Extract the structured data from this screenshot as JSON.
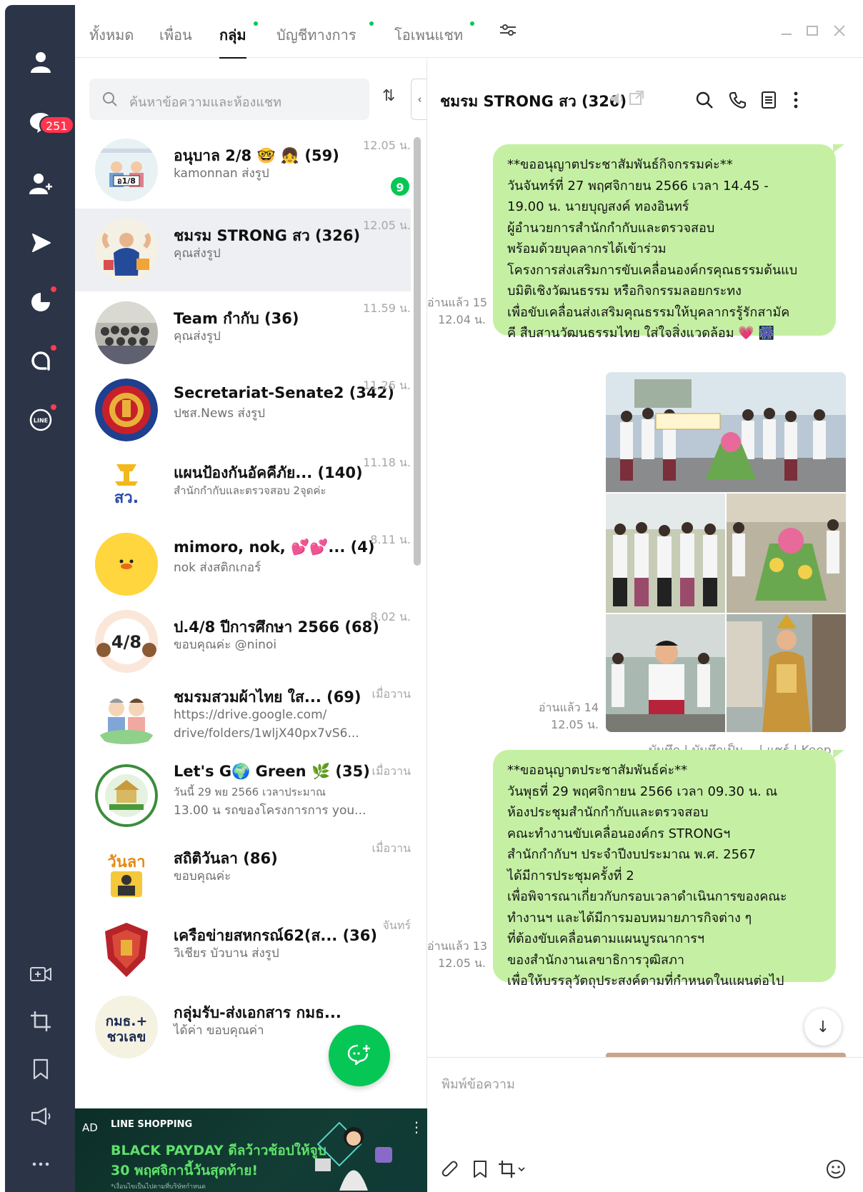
{
  "rail": {
    "badge_count": "251",
    "icons": [
      "user-icon",
      "chat-icon",
      "add-friend-icon",
      "voom-icon",
      "today-icon",
      "openchat-icon",
      "line-icon",
      "video-call-icon",
      "crop-icon",
      "bookmark-icon",
      "announce-icon",
      "more-icon"
    ]
  },
  "tabs": [
    {
      "label": "ทั้งหมด",
      "active": false,
      "dot": false
    },
    {
      "label": "เพื่อน",
      "active": false,
      "dot": false
    },
    {
      "label": "กลุ่ม",
      "active": true,
      "dot": true
    },
    {
      "label": "บัญชีทางการ",
      "active": false,
      "dot": true
    },
    {
      "label": "โอเพนแชท",
      "active": false,
      "dot": true
    }
  ],
  "search": {
    "placeholder": "ค้นหาข้อความและห้องแชท"
  },
  "chats": [
    {
      "title": "อนุบาล 2/8 🤓 👧 (59)",
      "sub": [
        "kamonnan ส่งรูป"
      ],
      "time": "12.05 น.",
      "unread": "9"
    },
    {
      "title": "ชมรม STRONG สว (326)",
      "sub": [
        "คุณส่งรูป"
      ],
      "time": "12.05 น.",
      "selected": true
    },
    {
      "title": "Team กำกับ (36)",
      "sub": [
        "คุณส่งรูป"
      ],
      "time": "11.59 น."
    },
    {
      "title": "Secretariat-Senate2 (342)",
      "sub": [
        "ปชส.News ส่งรูป"
      ],
      "time": "11.26 น."
    },
    {
      "title": "แผนป้องกันอัคคีภัย... (140)",
      "sub": [
        "สำนักกำกับและตรวจสอบ 2จุดค่ะ"
      ],
      "time": "11.18 น."
    },
    {
      "title": "mimoro, nok, 💕💕... (4)",
      "sub": [
        "nok ส่งสติกเกอร์"
      ],
      "time": "8.11 น."
    },
    {
      "title": "ป.4/8 ปีการศึกษา 2566 (68)",
      "sub": [
        "ขอบคุณค่ะ @ninoi"
      ],
      "time": "8.02 น."
    },
    {
      "title": "ชมรมสวมผ้าไทย ใส... (69)",
      "sub": [
        "https://drive.google.com/",
        "drive/folders/1wljX40px7vS6..."
      ],
      "time": "เมื่อวาน"
    },
    {
      "title": "Let's G🌍 Green 🌿 (35)",
      "sub": [
        "วันนี้ 29 พย 2566 เวลาประมาณ",
        "13.00 น รถของโครงการการ you..."
      ],
      "time": "เมื่อวาน"
    },
    {
      "title": "สถิติวันลา (86)",
      "sub": [
        "ขอบคุณค่ะ"
      ],
      "time": "เมื่อวาน"
    },
    {
      "title": "เครือข่ายสหกรณ์62(ส... (36)",
      "sub": [
        "วิเชียร บัวบาน ส่งรูป"
      ],
      "time": "จันทร์"
    },
    {
      "title": "กลุ่มรับ-ส่งเอกสาร กมธ...",
      "sub": [
        "ได้ค่า ขอบคุณค่า"
      ],
      "time": ""
    }
  ],
  "avatars": {
    "a1_label": "อ1/8",
    "a7_label": "4/8",
    "a10_label": "วันลา",
    "a12_top": "กมธ.+",
    "a12_bottom": "ชวเลข",
    "a5_label": "สว."
  },
  "ad": {
    "tag": "AD",
    "brand": "LINE SHOPPING",
    "line1": "BLACK PAYDAY ดีลว้าวช้อปให้จูบ",
    "line2": "30 พฤศจิกานี้วันสุดท้าย!",
    "fine": "*เงื่อนไขเป็นไปตามที่บริษัทกำหนด"
  },
  "chat": {
    "title": "ชมรม STRONG สว (326)",
    "messages": [
      {
        "lines": [
          "**ขออนุญาตประชาสัมพันธ์กิจกรรมค่ะ**",
          "วันจันทร์ที่ 27 พฤศจิกายน 2566 เวลา 14.45 -",
          "19.00 น. นายบุญสงค์ ทองอินทร์",
          "ผู้อำนวยการสำนักกำกับและตรวจสอบ",
          "พร้อมด้วยบุคลากรได้เข้าร่วม",
          "โครงการส่งเสริมการขับเคลื่อนองค์กรคุณธรรมต้นแบ",
          "บมิติเชิงวัฒนธรรม หรือกิจกรรมลอยกระทง",
          "เพื่อขับเคลื่อนส่งเสริมคุณธรรมให้บุคลากรรู้รักสามัค",
          "คี สืบสานวัฒนธรรมไทย ใส่ใจสิ่งแวดล้อม 💗 🎆"
        ],
        "read": "อ่านแล้ว 15",
        "time": "12.04 น."
      },
      {
        "read": "อ่านแล้ว 14",
        "time": "12.05 น.",
        "actions": "บันทึก | บันทึกเป็น... | แชร์ | Keep"
      },
      {
        "lines": [
          "**ขออนุญาตประชาสัมพันธ์ค่ะ**",
          "วันพุธที่ 29 พฤศจิกายน 2566 เวลา 09.30 น. ณ",
          "ห้องประชุมสำนักกำกับและตรวจสอบ",
          "คณะทำงานขับเคลื่อนองค์กร STRONGฯ",
          "สำนักกำกับฯ ประจำปีงบประมาณ พ.ศ. 2567",
          "ได้มีการประชุมครั้งที่ 2",
          "เพื่อพิจารณาเกี่ยวกับกรอบเวลาดำเนินการของคณะ",
          "ทำงานฯ และได้มีการมอบหมายภารกิจต่าง ๆ",
          "ที่ต้องขับเคลื่อนตามแผนบูรณาการฯ",
          "ของสำนักงานเลขาธิการวุฒิสภา",
          "เพื่อให้บรรลุวัตถุประสงค์ตามที่กำหนดในแผนต่อไป"
        ],
        "read": "อ่านแล้ว 13",
        "time": "12.05 น."
      }
    ],
    "input_placeholder": "พิมพ์ข้อความ"
  },
  "colors": {
    "accent": "#06c755",
    "bubble": "#c5f0a4",
    "rail": "#2c3447",
    "badge": "#ff334b"
  }
}
